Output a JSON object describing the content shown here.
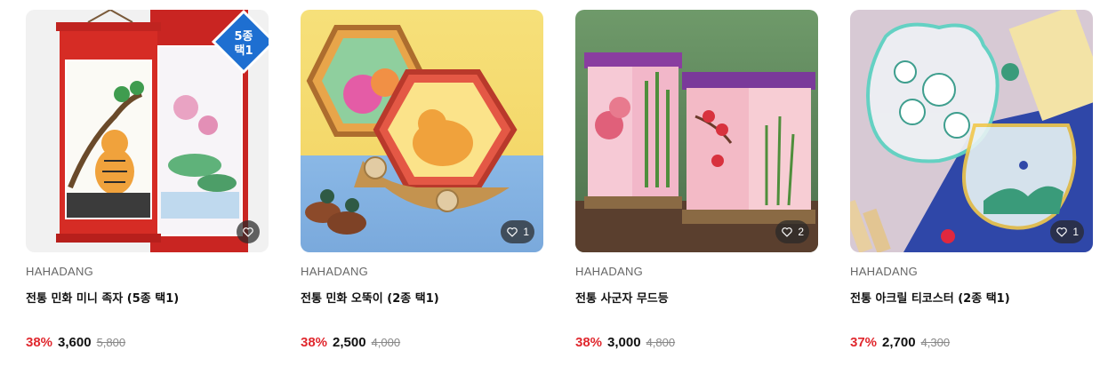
{
  "products": [
    {
      "brand": "HAHADANG",
      "title": "전통 민화 미니 족자 (5종 택1)",
      "discount": "38%",
      "price": "3,600",
      "original_price": "5,800",
      "likes": "",
      "badge": "5종택1"
    },
    {
      "brand": "HAHADANG",
      "title": "전통 민화 오뚝이 (2종 택1)",
      "discount": "38%",
      "price": "2,500",
      "original_price": "4,000",
      "likes": "1"
    },
    {
      "brand": "HAHADANG",
      "title": "전통 사군자 무드등",
      "discount": "38%",
      "price": "3,000",
      "original_price": "4,800",
      "likes": "2"
    },
    {
      "brand": "HAHADANG",
      "title": "전통 아크릴 티코스터 (2종 택1)",
      "discount": "37%",
      "price": "2,700",
      "original_price": "4,300",
      "likes": "1"
    }
  ],
  "icons": {
    "like": "heart-outline-icon"
  },
  "colors": {
    "discount": "#e0282e",
    "like_bg": "#333333"
  }
}
